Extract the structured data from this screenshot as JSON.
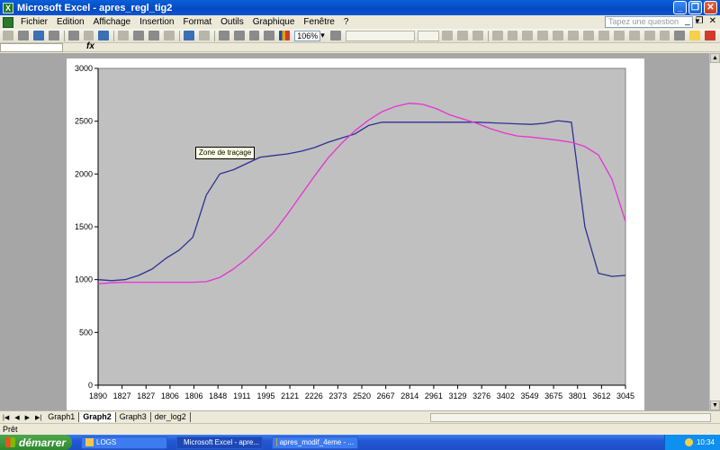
{
  "window": {
    "title": "Microsoft Excel - apres_regl_tig2",
    "controls": {
      "minimize": "_",
      "restore": "❐",
      "close": "✕"
    }
  },
  "menu": {
    "items": [
      "Fichier",
      "Edition",
      "Affichage",
      "Insertion",
      "Format",
      "Outils",
      "Graphique",
      "Fenêtre",
      "?"
    ],
    "help_placeholder": "Tapez une question"
  },
  "toolbar": {
    "zoom": "106%"
  },
  "formula_bar": {
    "fx_label": "fx"
  },
  "tooltip": {
    "text": "Zone de traçage"
  },
  "sheet_tabs": {
    "tabs": [
      "Graph1",
      "Graph2",
      "Graph3",
      "der_log2"
    ],
    "active": "Graph2"
  },
  "status": {
    "text": "Prêt"
  },
  "taskbar": {
    "start_label": "démarrer",
    "tasks": [
      {
        "label": "LOGS",
        "icon_color": "#f2c94c"
      },
      {
        "label": "Microsoft Excel - apre...",
        "icon_color": "#2a8a2a"
      },
      {
        "label": "apres_modif_4eme - ...",
        "icon_color": "#c9a04a"
      }
    ],
    "clock": "10:34"
  },
  "colors": {
    "plot_area": "#c0c0c0",
    "series_blue": "#2e3192",
    "series_magenta": "#e633d0"
  },
  "chart_data": {
    "type": "line",
    "title": "",
    "xlabel": "",
    "ylabel": "",
    "ylim": [
      0,
      3000
    ],
    "yticks": [
      0,
      500,
      1000,
      1500,
      2000,
      2500,
      3000
    ],
    "x_tick_labels": [
      "1890",
      "1827",
      "1827",
      "1806",
      "1806",
      "1848",
      "1911",
      "1995",
      "2121",
      "2226",
      "2373",
      "2520",
      "2667",
      "2814",
      "2961",
      "3129",
      "3276",
      "3402",
      "3549",
      "3675",
      "3801",
      "3612",
      "3045"
    ],
    "grid": false,
    "legend": "none",
    "series": [
      {
        "color": "blue",
        "values": [
          1000,
          990,
          1000,
          1040,
          1100,
          1200,
          1280,
          1400,
          1800,
          2000,
          2040,
          2100,
          2160,
          2175,
          2190,
          2215,
          2250,
          2300,
          2340,
          2380,
          2460,
          2490,
          2490,
          2490,
          2490,
          2490,
          2490,
          2490,
          2490,
          2485,
          2480,
          2475,
          2470,
          2480,
          2505,
          2490,
          1500,
          1060,
          1030,
          1040
        ]
      },
      {
        "color": "magenta",
        "values": [
          960,
          970,
          975,
          975,
          975,
          975,
          975,
          975,
          980,
          1020,
          1100,
          1200,
          1320,
          1450,
          1620,
          1800,
          1980,
          2150,
          2290,
          2410,
          2510,
          2590,
          2640,
          2670,
          2660,
          2620,
          2560,
          2520,
          2480,
          2430,
          2390,
          2360,
          2350,
          2335,
          2320,
          2300,
          2260,
          2180,
          1950,
          1550
        ]
      }
    ]
  }
}
